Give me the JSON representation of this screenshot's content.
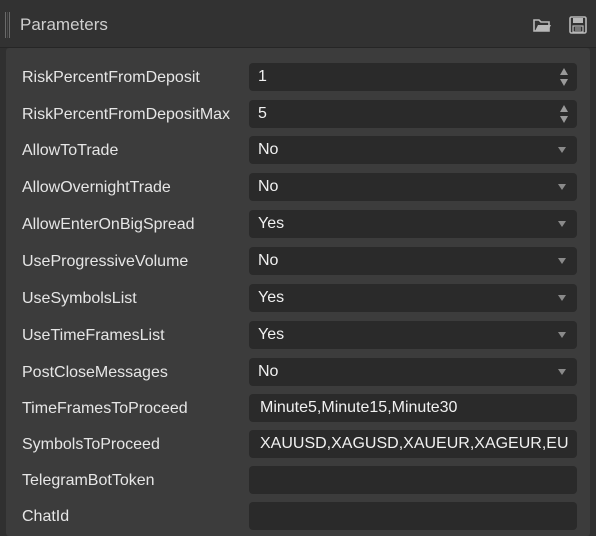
{
  "window": {
    "title": "Parameters",
    "icons": [
      "open-folder-icon",
      "save-icon"
    ]
  },
  "params": [
    {
      "label": "RiskPercentFromDeposit",
      "value": "1",
      "control": "number"
    },
    {
      "label": "RiskPercentFromDepositMax",
      "value": "5",
      "control": "number"
    },
    {
      "label": "AllowToTrade",
      "value": "No",
      "control": "dropdown"
    },
    {
      "label": "AllowOvernightTrade",
      "value": "No",
      "control": "dropdown"
    },
    {
      "label": "AllowEnterOnBigSpread",
      "value": "Yes",
      "control": "dropdown"
    },
    {
      "label": "UseProgressiveVolume",
      "value": "No",
      "control": "dropdown"
    },
    {
      "label": "UseSymbolsList",
      "value": "Yes",
      "control": "dropdown"
    },
    {
      "label": "UseTimeFramesList",
      "value": "Yes",
      "control": "dropdown"
    },
    {
      "label": "PostCloseMessages",
      "value": "No",
      "control": "dropdown"
    },
    {
      "label": "TimeFramesToProceed",
      "value": "Minute5,Minute15,Minute30",
      "control": "text"
    },
    {
      "label": "SymbolsToProceed",
      "value": "XAUUSD,XAGUSD,XAUEUR,XAGEUR,EU",
      "control": "text"
    },
    {
      "label": "TelegramBotToken",
      "value": "",
      "control": "text"
    },
    {
      "label": "ChatId",
      "value": "",
      "control": "text"
    }
  ]
}
